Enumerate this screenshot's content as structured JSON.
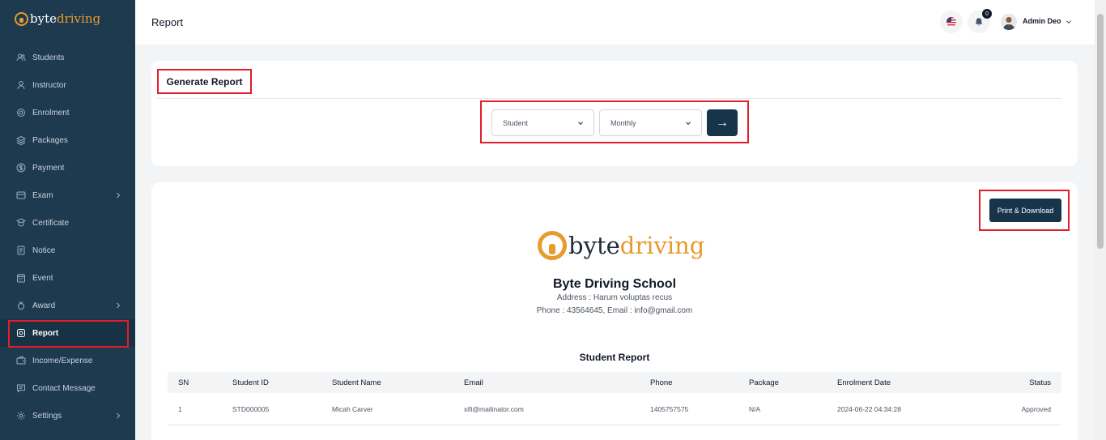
{
  "brand": {
    "part1": "byte",
    "part2": "driving"
  },
  "sidebar": {
    "items": [
      {
        "label": "Students",
        "icon": "users-icon"
      },
      {
        "label": "Instructor",
        "icon": "user-icon"
      },
      {
        "label": "Enrolment",
        "icon": "enrolment-icon"
      },
      {
        "label": "Packages",
        "icon": "layers-icon"
      },
      {
        "label": "Payment",
        "icon": "dollar-icon"
      },
      {
        "label": "Exam",
        "icon": "exam-icon",
        "has_submenu": true
      },
      {
        "label": "Certificate",
        "icon": "certificate-icon"
      },
      {
        "label": "Notice",
        "icon": "notice-icon"
      },
      {
        "label": "Event",
        "icon": "calendar-icon"
      },
      {
        "label": "Award",
        "icon": "award-icon",
        "has_submenu": true
      },
      {
        "label": "Report",
        "icon": "report-icon",
        "active": true
      },
      {
        "label": "Income/Expense",
        "icon": "wallet-icon"
      },
      {
        "label": "Contact Message",
        "icon": "message-icon"
      },
      {
        "label": "Settings",
        "icon": "gear-icon",
        "has_submenu": true
      }
    ]
  },
  "header": {
    "title": "Report",
    "notification_count": "0",
    "user_name": "Admin Deo"
  },
  "generate": {
    "title": "Generate Report",
    "type_select": "Student",
    "period_select": "Monthly",
    "go_label": "→"
  },
  "report": {
    "print_label": "Print & Download",
    "school_name": "Byte Driving School",
    "address": "Address : Harum voluptas recus",
    "contact": "Phone : 43564645, Email : info@gmail.com",
    "title": "Student Report",
    "columns": [
      "SN",
      "Student ID",
      "Student Name",
      "Email",
      "Phone",
      "Package",
      "Enrolment Date",
      "Status"
    ],
    "rows": [
      [
        "1",
        "STD000005",
        "Micah Carver",
        "xifi@mailinator.com",
        "1405757575",
        "N/A",
        "2024-06-22 04:34:28",
        "Approved"
      ]
    ]
  },
  "colors": {
    "sidebar": "#1d3a4f",
    "accent": "#e89a2c",
    "primary_button": "#16344a",
    "highlight": "#e11d2a"
  }
}
